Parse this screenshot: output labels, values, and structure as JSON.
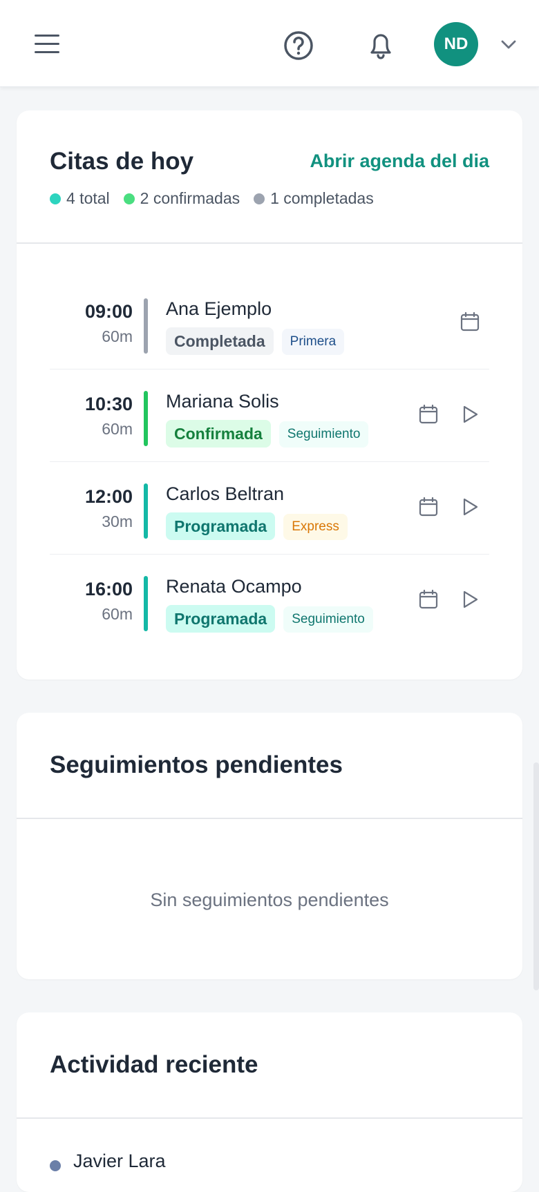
{
  "header": {
    "avatar_initials": "ND",
    "icons": [
      "menu-icon",
      "help-icon",
      "bell-icon",
      "chevron-down-icon"
    ]
  },
  "today": {
    "title": "Citas de hoy",
    "open_link": "Abrir agenda del dia",
    "stats": [
      {
        "label": "4 total",
        "color": "#2dd4bf"
      },
      {
        "label": "2 confirmadas",
        "color": "#4ade80"
      },
      {
        "label": "1 completadas",
        "color": "#9ca3af"
      }
    ],
    "appointments": [
      {
        "time": "09:00",
        "duration": "60m",
        "patient": "Ana Ejemplo",
        "status": "Completada",
        "type": "Primera",
        "bar_color": "#9ca3af",
        "status_bg": "#f1f3f5",
        "status_fg": "#4b5563",
        "type_bg": "#f3f6fb",
        "type_fg": "#1e4f8a",
        "actions": [
          "calendar-icon"
        ]
      },
      {
        "time": "10:30",
        "duration": "60m",
        "patient": "Mariana Solis",
        "status": "Confirmada",
        "type": "Seguimiento",
        "bar_color": "#22c55e",
        "status_bg": "#dcfce7",
        "status_fg": "#15803d",
        "type_bg": "#f0fdfa",
        "type_fg": "#0f766e",
        "actions": [
          "calendar-icon",
          "play-icon"
        ]
      },
      {
        "time": "12:00",
        "duration": "30m",
        "patient": "Carlos Beltran",
        "status": "Programada",
        "type": "Express",
        "bar_color": "#14b8a6",
        "status_bg": "#ccfbf1",
        "status_fg": "#0f766e",
        "type_bg": "#fef9e7",
        "type_fg": "#d97706",
        "actions": [
          "calendar-icon",
          "play-icon"
        ]
      },
      {
        "time": "16:00",
        "duration": "60m",
        "patient": "Renata Ocampo",
        "status": "Programada",
        "type": "Seguimiento",
        "bar_color": "#14b8a6",
        "status_bg": "#ccfbf1",
        "status_fg": "#0f766e",
        "type_bg": "#f0fdfa",
        "type_fg": "#0f766e",
        "actions": [
          "calendar-icon",
          "play-icon"
        ]
      }
    ]
  },
  "followups": {
    "title": "Seguimientos pendientes",
    "empty": "Sin seguimientos pendientes"
  },
  "recent": {
    "title": "Actividad reciente",
    "items": [
      {
        "name": "Javier Lara"
      }
    ]
  },
  "colors": {
    "accent": "#11917f"
  }
}
